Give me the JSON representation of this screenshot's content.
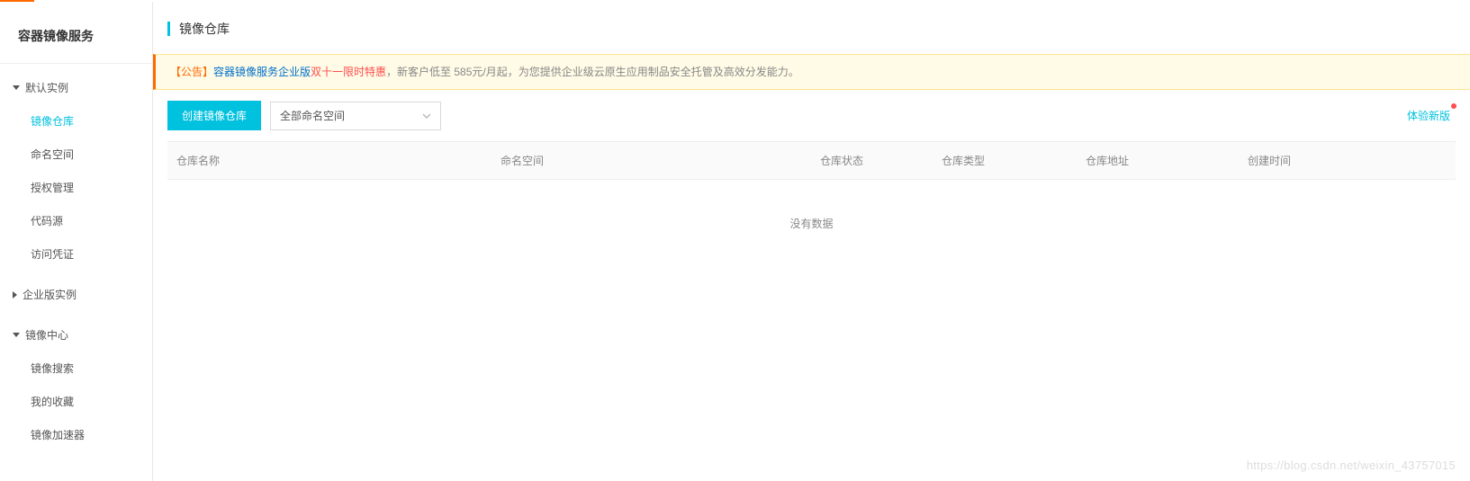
{
  "sidebar": {
    "title": "容器镜像服务",
    "groups": [
      {
        "label": "默认实例",
        "expanded": true,
        "items": [
          {
            "label": "镜像仓库",
            "active": true
          },
          {
            "label": "命名空间",
            "active": false
          },
          {
            "label": "授权管理",
            "active": false
          },
          {
            "label": "代码源",
            "active": false
          },
          {
            "label": "访问凭证",
            "active": false
          }
        ]
      },
      {
        "label": "企业版实例",
        "expanded": false,
        "items": []
      },
      {
        "label": "镜像中心",
        "expanded": true,
        "items": [
          {
            "label": "镜像搜索",
            "active": false
          },
          {
            "label": "我的收藏",
            "active": false
          },
          {
            "label": "镜像加速器",
            "active": false
          }
        ]
      }
    ]
  },
  "page": {
    "title": "镜像仓库"
  },
  "notice": {
    "tag": "【公告】",
    "strong": "容器镜像服务企业版",
    "red": "双十一限时特惠",
    "rest": "，新客户低至 585元/月起，为您提供企业级云原生应用制品安全托管及高效分发能力。"
  },
  "toolbar": {
    "create_label": "创建镜像仓库",
    "namespace_selected": "全部命名空间",
    "new_version_label": "体验新版"
  },
  "table": {
    "headers": [
      "仓库名称",
      "命名空间",
      "仓库状态",
      "仓库类型",
      "仓库地址",
      "创建时间"
    ],
    "empty_text": "没有数据",
    "rows": []
  },
  "watermark": "https://blog.csdn.net/weixin_43757015"
}
